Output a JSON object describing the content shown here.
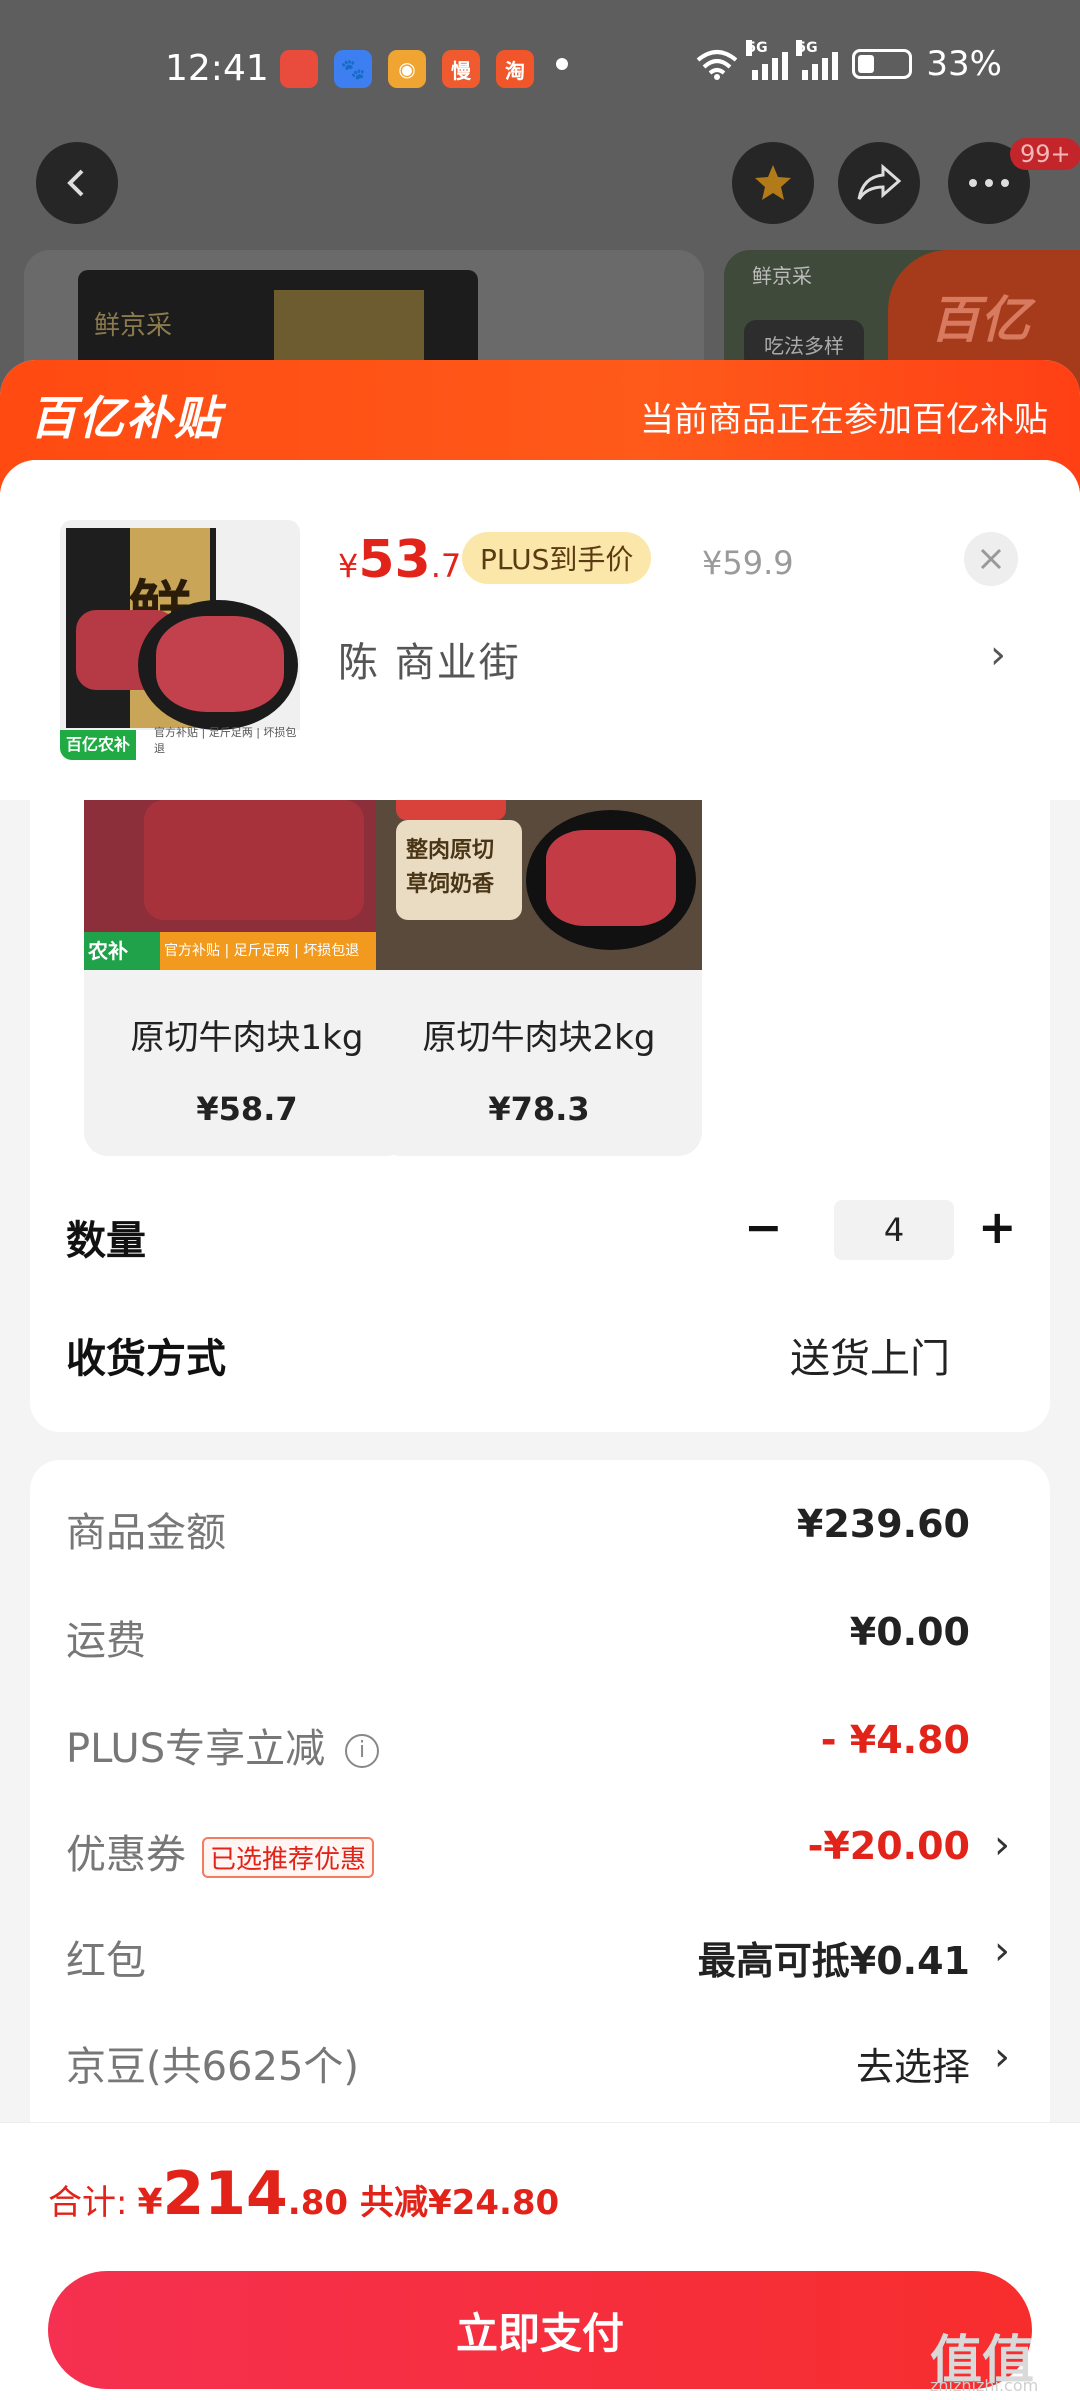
{
  "status_bar": {
    "time": "12:41",
    "apps": [
      {
        "icon": "app-icon-1",
        "color": "#e94b3c",
        "glyph": ""
      },
      {
        "icon": "baidu-icon",
        "color": "#3d7ff0",
        "glyph": "🐾"
      },
      {
        "icon": "weibo-icon",
        "color": "#f0a431",
        "glyph": "◉"
      },
      {
        "icon": "man-icon",
        "color": "#ef5b2f",
        "glyph": "慢"
      },
      {
        "icon": "taobao-icon",
        "color": "#f0562a",
        "glyph": "淘"
      }
    ],
    "signal_label": "5G",
    "battery_percent": "33%",
    "battery_level": 0.33
  },
  "nav": {
    "badge": "99+"
  },
  "background": {
    "brand_left": "鲜京采",
    "brand_right": "鲜京采",
    "right_button": "吃法多样",
    "corner_logo": "百亿"
  },
  "banner": {
    "logo": "百亿补贴",
    "note": "当前商品正在参加百亿补贴"
  },
  "product": {
    "price_symbol": "¥",
    "price_int": "53",
    "price_dec": ".7",
    "plus_tag": "PLUS到手价",
    "original_price": "¥59.9",
    "address": "陈  商业街",
    "thumb_char": "鲜",
    "thumb_tag": "百亿农补",
    "thumb_text": "官方补贴 | 足斤足两 | 坏损包退"
  },
  "variants": [
    {
      "name": "原切牛肉块1kg",
      "price": "¥58.7",
      "tag": "农补",
      "strip_text": "官方补贴 | 足斤足两 | 坏损包退"
    },
    {
      "name": "原切牛肉块2kg",
      "price": "¥78.3",
      "label": "整肉原切 草饲奶香"
    }
  ],
  "quantity": {
    "label": "数量",
    "value": "4",
    "minus": "−",
    "plus": "+"
  },
  "shipping": {
    "label": "收货方式",
    "value": "送货上门"
  },
  "costs": [
    {
      "label": "商品金额",
      "value": "¥239.60",
      "style": "bold"
    },
    {
      "label": "运费",
      "value": "¥0.00",
      "style": "bold"
    },
    {
      "label": "PLUS专享立减",
      "value": "- ¥4.80",
      "style": "red",
      "info": "i"
    },
    {
      "label": "优惠券",
      "value": "-¥20.00",
      "style": "red",
      "tag": "已选推荐优惠",
      "chevron": "›"
    },
    {
      "label": "红包",
      "value": "最高可抵¥0.41",
      "style": "bold",
      "chevron": "›"
    },
    {
      "label": "京豆(共6625个)",
      "value": "去选择",
      "style": "norm",
      "chevron": "›"
    }
  ],
  "total": {
    "label": "合计:",
    "yen": "¥",
    "int": "214",
    "dec": ".80",
    "saved": "共减¥24.80"
  },
  "pay_button": "立即支付",
  "watermark": {
    "main": "值值值",
    "sub": "zhizhizhi.com"
  },
  "colors": {
    "accent_red": "#e2231a",
    "banner_orange": "#ff4a12",
    "pay_gradient_start": "#f53050"
  }
}
